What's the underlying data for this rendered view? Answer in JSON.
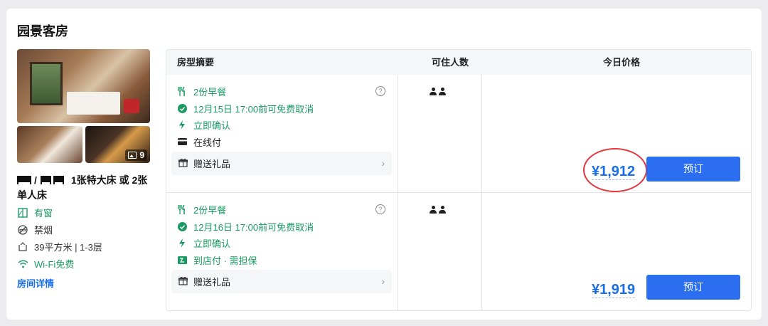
{
  "section_title": "园景客房",
  "room": {
    "photo_count": "9",
    "bed_text": "1张特大床 或 2张单人床",
    "features": [
      {
        "icon": "window-icon",
        "label": "有窗",
        "green": true
      },
      {
        "icon": "no-smoking-icon",
        "label": "禁烟",
        "green": false
      },
      {
        "icon": "area-icon",
        "label": "39平方米 | 1-3层",
        "green": false
      },
      {
        "icon": "wifi-icon",
        "label": "Wi-Fi免费",
        "green": true
      }
    ],
    "detail_link": "房间详情"
  },
  "table": {
    "headers": [
      "房型摘要",
      "可住人数",
      "今日价格"
    ],
    "rows": [
      {
        "breakfast": "2份早餐",
        "cancel": "12月15日 17:00前可免费取消",
        "confirm": "立即确认",
        "payment": "在线付",
        "gift": "赠送礼品",
        "price": "¥1,912",
        "book": "预订",
        "guests": 2
      },
      {
        "breakfast": "2份早餐",
        "cancel": "12月16日 17:00前可免费取消",
        "confirm": "立即确认",
        "payment": "到店付 · 需担保",
        "gift": "赠送礼品",
        "price": "¥1,919",
        "book": "预订",
        "guests": 2
      }
    ]
  },
  "colors": {
    "accent": "#2b6ff0",
    "price": "#1a6ee8",
    "green": "#1a9a63",
    "highlight": "#e2373e"
  }
}
